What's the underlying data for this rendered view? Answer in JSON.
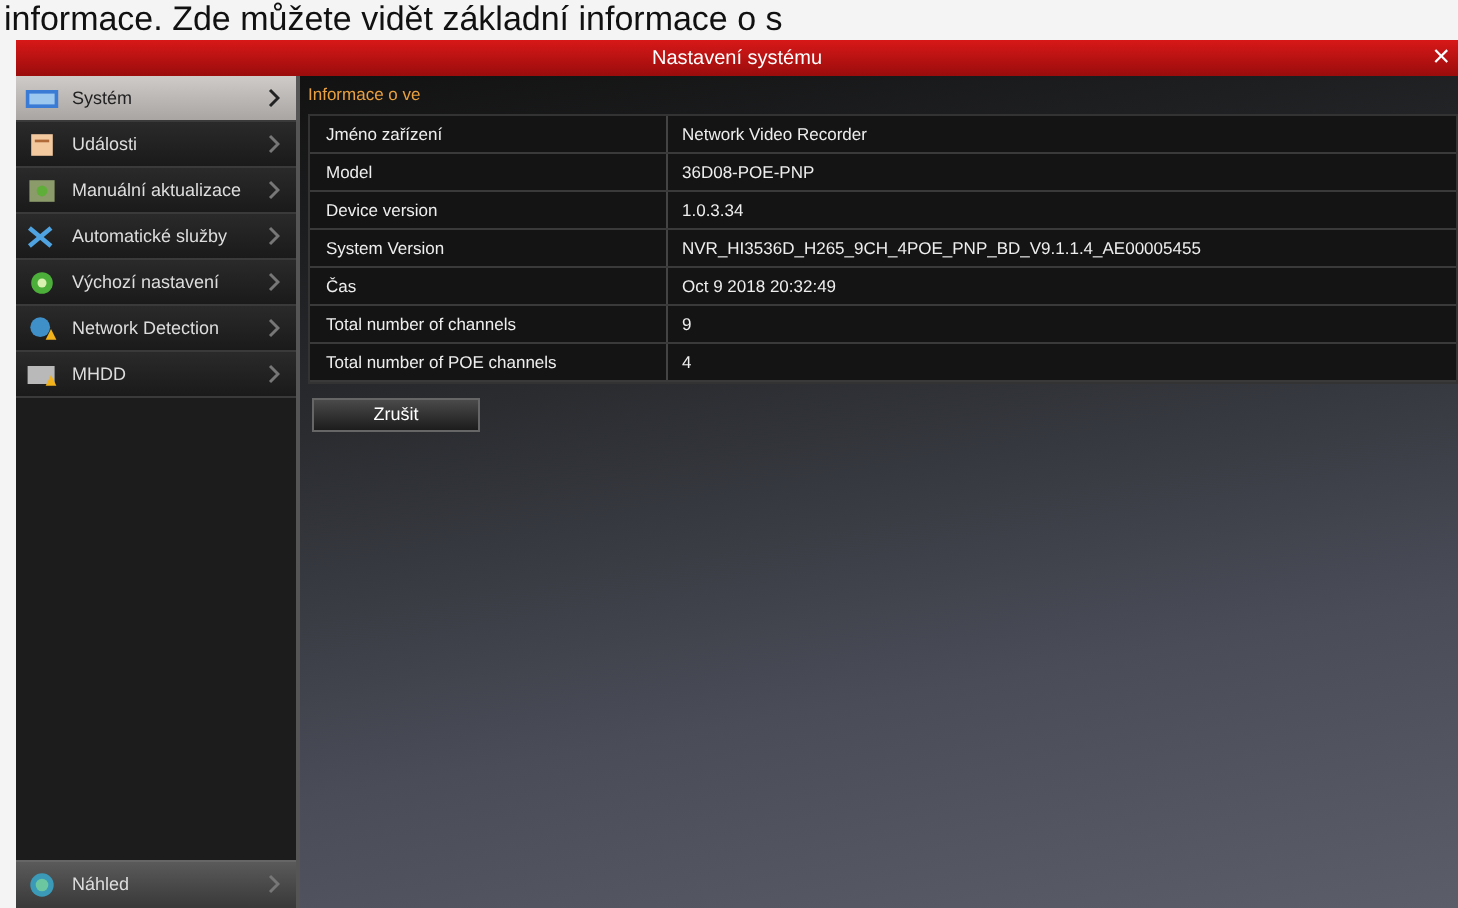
{
  "caption": "informace. Zde můžete vidět základní informace o s",
  "window": {
    "title": "Nastavení systému",
    "close": "×"
  },
  "sidebar": {
    "items": [
      {
        "label": "Systém",
        "selected": true
      },
      {
        "label": "Události",
        "selected": false
      },
      {
        "label": "Manuální aktualizace",
        "selected": false
      },
      {
        "label": "Automatické služby",
        "selected": false
      },
      {
        "label": "Výchozí nastavení",
        "selected": false
      },
      {
        "label": "Network Detection",
        "selected": false
      },
      {
        "label": "MHDD",
        "selected": false
      }
    ],
    "bottom_item": {
      "label": "Náhled",
      "selected": false
    }
  },
  "section_title": "Informace o ve",
  "info_rows": [
    {
      "label": "Jméno zařízení",
      "value": "Network Video Recorder"
    },
    {
      "label": "Model",
      "value": "36D08-POE-PNP"
    },
    {
      "label": "Device version",
      "value": "1.0.3.34"
    },
    {
      "label": "System Version",
      "value": "NVR_HI3536D_H265_9CH_4POE_PNP_BD_V9.1.1.4_AE00005455"
    },
    {
      "label": "Čas",
      "value": "Oct  9 2018   20:32:49"
    },
    {
      "label": "Total number of channels",
      "value": "9"
    },
    {
      "label": "Total number of POE channels",
      "value": "4"
    }
  ],
  "buttons": [
    "Zrušit"
  ]
}
